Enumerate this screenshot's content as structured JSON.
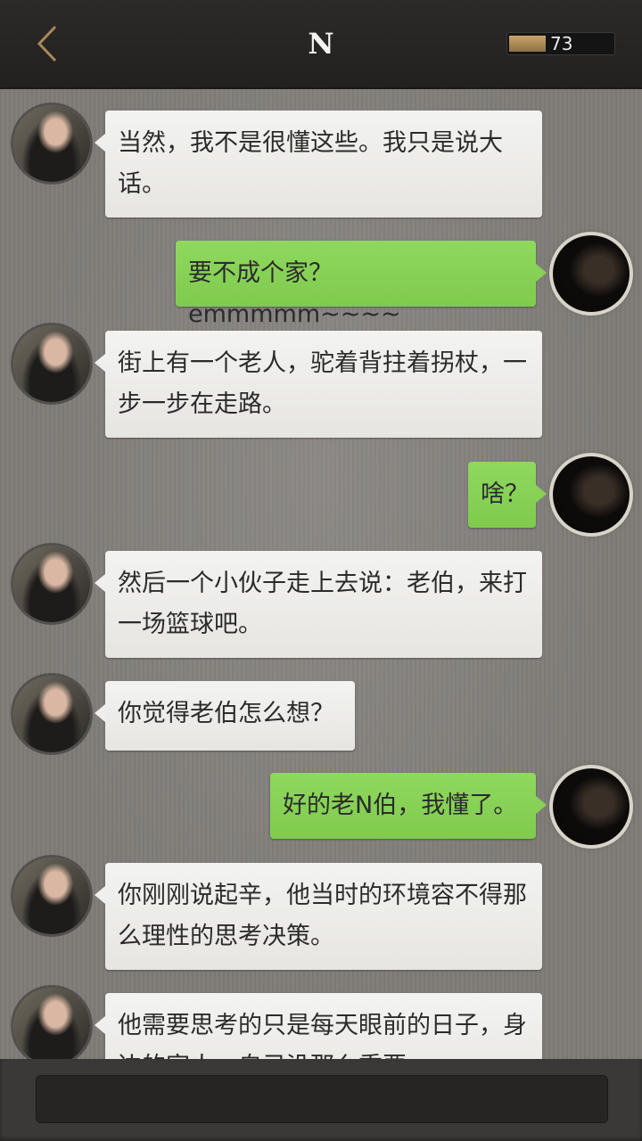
{
  "header": {
    "title": "N",
    "energy_value": "73",
    "energy_level": 0.35
  },
  "messages": [
    {
      "side": "left",
      "text": "当然，我不是很懂这些。我只是说大话。"
    },
    {
      "side": "right",
      "text": "要不成个家？emmmmm~~~~"
    },
    {
      "side": "left",
      "text": "街上有一个老人，驼着背拄着拐杖，一步一步在走路。"
    },
    {
      "side": "right",
      "text": "啥？"
    },
    {
      "side": "left",
      "text": "然后一个小伙子走上去说：老伯，来打一场篮球吧。"
    },
    {
      "side": "left",
      "text": "你觉得老伯怎么想？"
    },
    {
      "side": "right",
      "text": "好的老N伯，我懂了。"
    },
    {
      "side": "left",
      "text": "你刚刚说起辛，他当时的环境容不得那么理性的思考决策。"
    },
    {
      "side": "left",
      "text": "他需要思考的只是每天眼前的日子，身边的家人，自己没那么重要。"
    }
  ],
  "icons": {
    "back": "chevron-left-icon"
  },
  "colors": {
    "header_bg": "#262423",
    "incoming_bubble": "#efefed",
    "outgoing_bubble": "#86d156",
    "back_arrow": "#a8895a"
  }
}
